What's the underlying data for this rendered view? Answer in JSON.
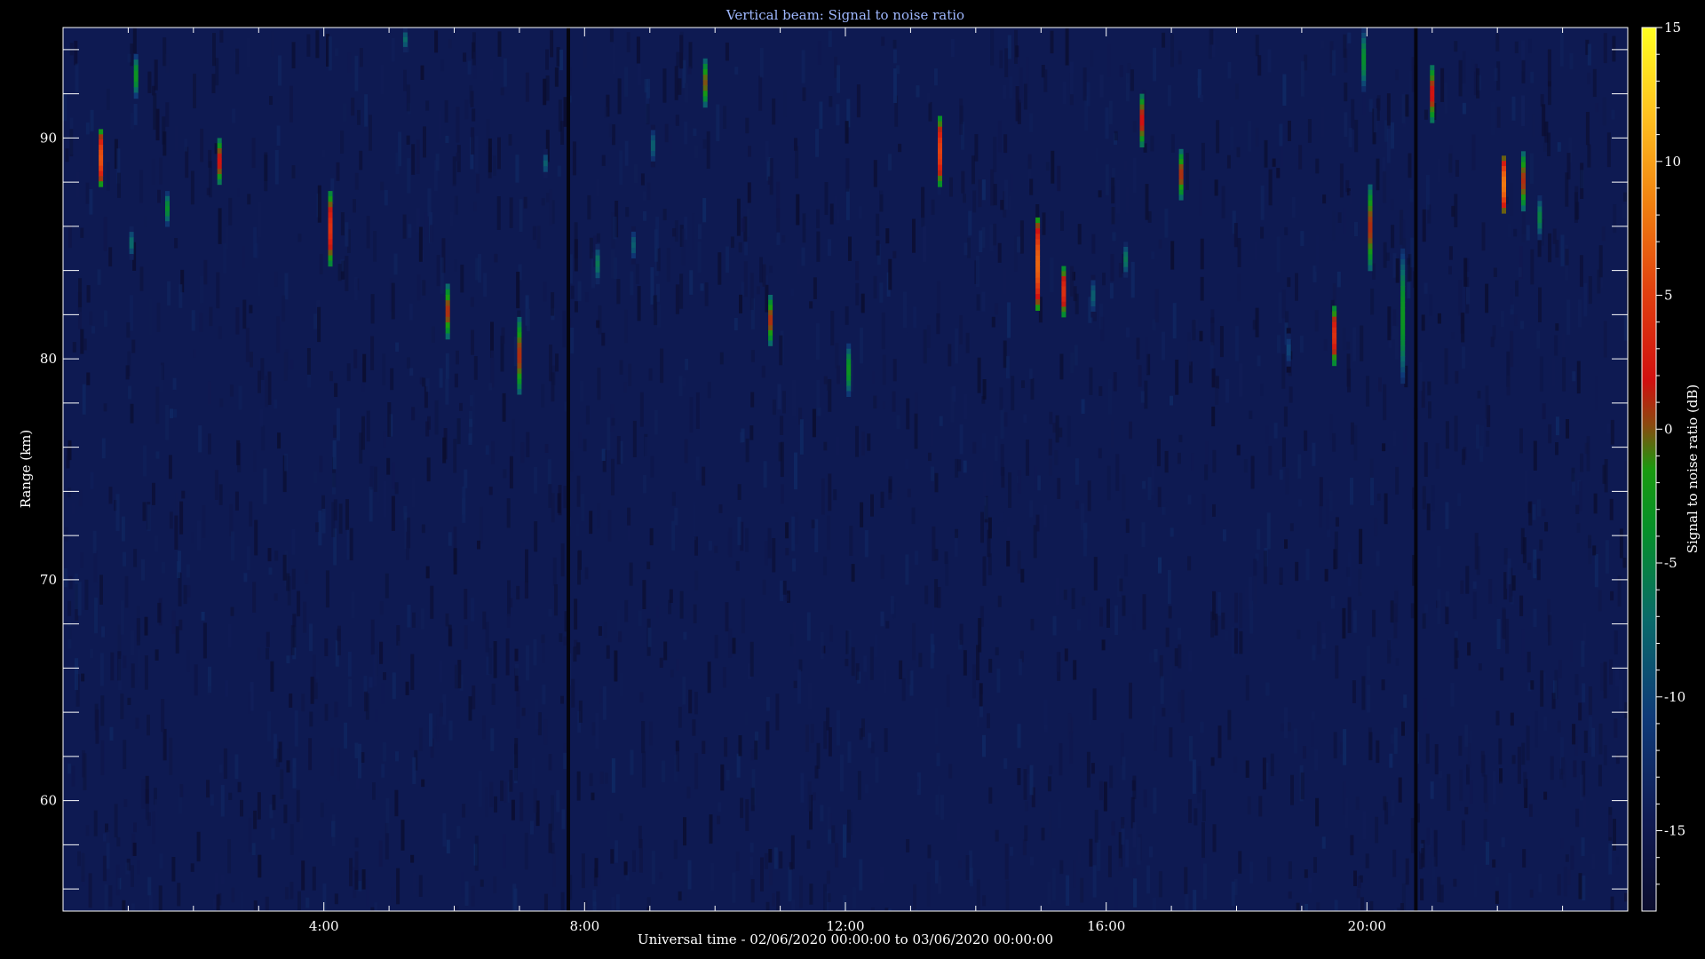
{
  "chart_data": {
    "type": "heatmap",
    "title": "Vertical beam: Signal to noise ratio",
    "xlabel": "Universal time - 02/06/2020 00:00:00 to 03/06/2020 00:00:00",
    "ylabel": "Range (km)",
    "colorbar_label": "Signal to noise ratio (dB)",
    "xlim": [
      0.0,
      24.0
    ],
    "ylim": [
      55.0,
      95.0
    ],
    "clim": [
      -18.0,
      15.0
    ],
    "x_ticks": [
      {
        "value": 4,
        "label": "4:00"
      },
      {
        "value": 8,
        "label": "8:00"
      },
      {
        "value": 12,
        "label": "12:00"
      },
      {
        "value": 16,
        "label": "16:00"
      },
      {
        "value": 20,
        "label": "20:00"
      }
    ],
    "y_ticks": [
      {
        "value": 60,
        "label": "60"
      },
      {
        "value": 70,
        "label": "70"
      },
      {
        "value": 80,
        "label": "80"
      },
      {
        "value": 90,
        "label": "90"
      }
    ],
    "colorbar_ticks": [
      {
        "value": 15,
        "label": "15"
      },
      {
        "value": 10,
        "label": "10"
      },
      {
        "value": 5,
        "label": "5"
      },
      {
        "value": 0,
        "label": "0"
      },
      {
        "value": -5,
        "label": "-5"
      },
      {
        "value": -10,
        "label": "-10"
      },
      {
        "value": -15,
        "label": "-15"
      }
    ],
    "background_snr": -16,
    "data_gaps_hours": [
      7.75,
      20.75
    ],
    "echoes": [
      {
        "time": 0.58,
        "range_min": 87.8,
        "range_max": 90.4,
        "peak_snr": 6
      },
      {
        "time": 1.12,
        "range_min": 91.8,
        "range_max": 93.8,
        "peak_snr": -3
      },
      {
        "time": 1.05,
        "range_min": 84.5,
        "range_max": 86.0,
        "peak_snr": -7
      },
      {
        "time": 1.6,
        "range_min": 86.0,
        "range_max": 87.6,
        "peak_snr": -4
      },
      {
        "time": 2.4,
        "range_min": 87.9,
        "range_max": 90.0,
        "peak_snr": 2
      },
      {
        "time": 4.1,
        "range_min": 84.2,
        "range_max": 87.6,
        "peak_snr": 4
      },
      {
        "time": 5.25,
        "range_min": 93.9,
        "range_max": 95.0,
        "peak_snr": -7
      },
      {
        "time": 5.9,
        "range_min": 80.9,
        "range_max": 83.4,
        "peak_snr": 1
      },
      {
        "time": 7.0,
        "range_min": 78.4,
        "range_max": 81.9,
        "peak_snr": 1
      },
      {
        "time": 7.4,
        "range_min": 88.2,
        "range_max": 89.5,
        "peak_snr": -8
      },
      {
        "time": 8.2,
        "range_min": 83.4,
        "range_max": 85.2,
        "peak_snr": -6
      },
      {
        "time": 8.75,
        "range_min": 84.3,
        "range_max": 86.0,
        "peak_snr": -8
      },
      {
        "time": 9.05,
        "range_min": 88.7,
        "range_max": 90.6,
        "peak_snr": -8
      },
      {
        "time": 9.85,
        "range_min": 91.4,
        "range_max": 93.6,
        "peak_snr": 0
      },
      {
        "time": 10.85,
        "range_min": 80.6,
        "range_max": 82.9,
        "peak_snr": 1
      },
      {
        "time": 12.05,
        "range_min": 78.3,
        "range_max": 80.7,
        "peak_snr": -3
      },
      {
        "time": 13.45,
        "range_min": 87.8,
        "range_max": 91.0,
        "peak_snr": 5
      },
      {
        "time": 14.95,
        "range_min": 82.2,
        "range_max": 86.4,
        "peak_snr": 7
      },
      {
        "time": 15.35,
        "range_min": 81.9,
        "range_max": 84.2,
        "peak_snr": 4
      },
      {
        "time": 15.8,
        "range_min": 81.9,
        "range_max": 83.8,
        "peak_snr": -8
      },
      {
        "time": 16.3,
        "range_min": 83.7,
        "range_max": 85.3,
        "peak_snr": -6
      },
      {
        "time": 16.55,
        "range_min": 89.6,
        "range_max": 92.0,
        "peak_snr": 2
      },
      {
        "time": 17.15,
        "range_min": 87.2,
        "range_max": 89.5,
        "peak_snr": 1
      },
      {
        "time": 18.8,
        "range_min": 79.4,
        "range_max": 81.4,
        "peak_snr": -10
      },
      {
        "time": 19.5,
        "range_min": 79.7,
        "range_max": 82.4,
        "peak_snr": 4
      },
      {
        "time": 19.95,
        "range_min": 92.1,
        "range_max": 95.0,
        "peak_snr": -4
      },
      {
        "time": 20.05,
        "range_min": 84.0,
        "range_max": 87.9,
        "peak_snr": 1
      },
      {
        "time": 20.55,
        "range_min": 78.9,
        "range_max": 85.0,
        "peak_snr": -3
      },
      {
        "time": 21.0,
        "range_min": 90.7,
        "range_max": 93.3,
        "peak_snr": 2
      },
      {
        "time": 22.1,
        "range_min": 86.6,
        "range_max": 89.2,
        "peak_snr": 8
      },
      {
        "time": 22.4,
        "range_min": 86.7,
        "range_max": 89.4,
        "peak_snr": 1
      },
      {
        "time": 22.65,
        "range_min": 85.4,
        "range_max": 87.4,
        "peak_snr": -5
      }
    ]
  }
}
